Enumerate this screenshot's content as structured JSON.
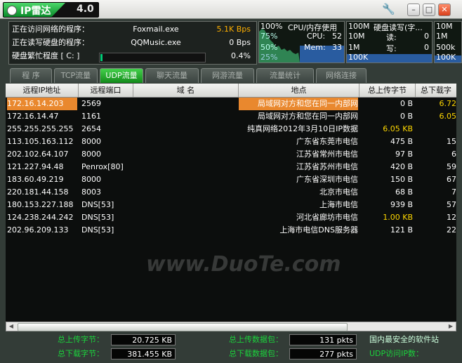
{
  "app": {
    "title": "IP雷达",
    "version": "4.0"
  },
  "info": {
    "net_label": "正在访问网络的程序：",
    "net_program": "Foxmail.exe",
    "net_speed": "5.1K Bps",
    "disk_label": "正在读写硬盘的程序：",
    "disk_program": "QQMusic.exe",
    "disk_speed": "0 Bps",
    "busy_label": "硬盘繁忙程度 [ C: ]",
    "busy_value": "0.4%"
  },
  "cpu_monitor": {
    "title": "CPU/内存使用",
    "p100": "100%",
    "p75": "75%",
    "p50": "50%",
    "p25": "25%",
    "cpu_label": "CPU:",
    "cpu_value": "52",
    "mem_label": "Mem:",
    "mem_value": "33"
  },
  "disk_monitor": {
    "title": "硬盘读写(字...",
    "s1": "100M",
    "s2": "10M",
    "s3": "1M",
    "s4": "100K",
    "read_label": "读:",
    "read_value": "0",
    "write_label": "写:",
    "write_value": "0"
  },
  "net_monitor": {
    "s1": "10M",
    "s2": "1M",
    "s3": "500k",
    "s4": "100K"
  },
  "tabs": [
    "程 序",
    "TCP流量",
    "UDP流量",
    "聊天流量",
    "网游流量",
    "流量统计",
    "网络连接"
  ],
  "active_tab": 2,
  "table": {
    "headers": [
      "远程IP地址",
      "远程端口",
      "域 名",
      "地点",
      "总上传字节",
      "总下载字"
    ],
    "rows": [
      {
        "ip": "172.16.14.203",
        "port": "2569",
        "domain": "",
        "loc": "局域网对方和您在同一内部网",
        "up": "0 B",
        "down": "6.72",
        "sel": true
      },
      {
        "ip": "172.16.14.47",
        "port": "1161",
        "domain": "",
        "loc": "局域网对方和您在同一内部网",
        "up": "0 B",
        "down": "6.05",
        "sel": false
      },
      {
        "ip": "255.255.255.255",
        "port": "2654",
        "domain": "",
        "loc": "纯真网络2012年3月10日IP数据",
        "up": "6.05 KB",
        "down": "",
        "sel": false
      },
      {
        "ip": "113.105.163.112",
        "port": "8000",
        "domain": "",
        "loc": "广东省东莞市电信",
        "up": "475 B",
        "down": "15",
        "sel": false
      },
      {
        "ip": "202.102.64.107",
        "port": "8000",
        "domain": "",
        "loc": "江苏省常州市电信",
        "up": "97 B",
        "down": "6",
        "sel": false
      },
      {
        "ip": "121.227.94.48",
        "port": "Penrox[80]",
        "domain": "",
        "loc": "江苏省苏州市电信",
        "up": "420 B",
        "down": "59",
        "sel": false
      },
      {
        "ip": "183.60.49.219",
        "port": "8000",
        "domain": "",
        "loc": "广东省深圳市电信",
        "up": "150 B",
        "down": "67",
        "sel": false
      },
      {
        "ip": "220.181.44.158",
        "port": "8003",
        "domain": "",
        "loc": "北京市电信",
        "up": "68 B",
        "down": "7",
        "sel": false
      },
      {
        "ip": "180.153.227.188",
        "port": "DNS[53]",
        "domain": "",
        "loc": "上海市电信",
        "up": "939 B",
        "down": "57",
        "sel": false
      },
      {
        "ip": "124.238.244.242",
        "port": "DNS[53]",
        "domain": "",
        "loc": "河北省廊坊市电信",
        "up": "1.00 KB",
        "down": "12",
        "sel": false
      },
      {
        "ip": "202.96.209.133",
        "port": "DNS[53]",
        "domain": "",
        "loc": "上海市电信DNS服务器",
        "up": "121 B",
        "down": "22",
        "sel": false
      }
    ]
  },
  "footer": {
    "up_bytes_label": "总上传字节：",
    "up_bytes": "20.725 KB",
    "down_bytes_label": "总下载字节：",
    "down_bytes": "381.455 KB",
    "up_pkts_label": "总上传数据包：",
    "up_pkts": "131 pkts",
    "down_pkts_label": "总下载数据包：",
    "down_pkts": "277 pkts",
    "tcp_label": "国内最安全的软件站",
    "udp_label": "UDP访问IP数："
  },
  "watermark": "www.DuoTe.com",
  "colors": {
    "accent_green": "#1bd43c",
    "selected_row": "#e9882e",
    "highlight_yellow": "#ffd800",
    "speed_orange": "#ffb000"
  }
}
